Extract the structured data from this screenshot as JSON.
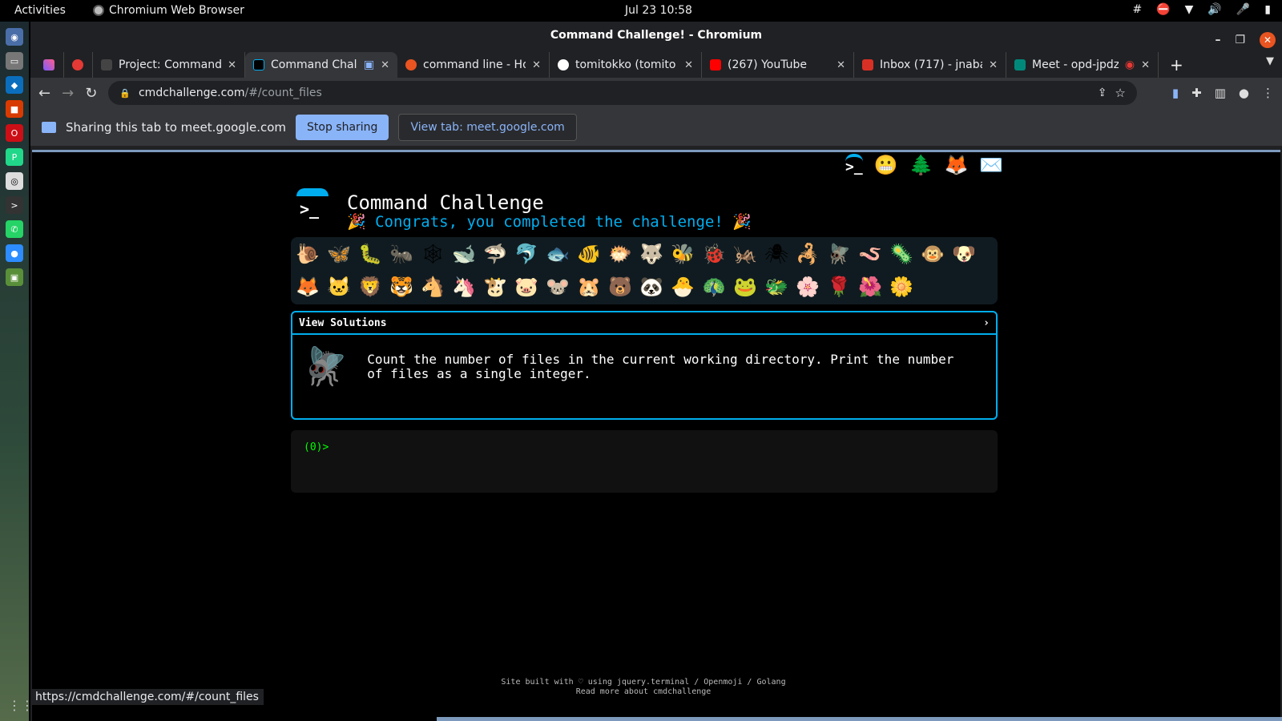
{
  "os": {
    "activities": "Activities",
    "app_name": "Chromium Web Browser",
    "clock": "Jul 23  10:58"
  },
  "window": {
    "title": "Command Challenge! - Chromium",
    "tabs": [
      {
        "label": "",
        "icon": "gradient-a-icon",
        "color": "#7b5cff"
      },
      {
        "label": "",
        "icon": "heart-icon",
        "color": "#e53935"
      },
      {
        "label": "Project: Command",
        "icon": "ofc-icon",
        "color": "#555"
      },
      {
        "label": "Command Chall",
        "icon": "terminal-icon",
        "color": "#00aeef",
        "active": true
      },
      {
        "label": "command line - Ho",
        "icon": "askubuntu-icon",
        "color": "#e95420"
      },
      {
        "label": "tomitokko (tomito",
        "icon": "github-icon",
        "color": "#fff"
      },
      {
        "label": "(267) YouTube",
        "icon": "youtube-icon",
        "color": "#ff0000"
      },
      {
        "label": "Inbox (717) - jnaba",
        "icon": "gmail-icon",
        "color": "#d93025"
      },
      {
        "label": "Meet - opd-jpdz",
        "icon": "meet-icon",
        "color": "#00897b"
      }
    ],
    "new_tab": "+",
    "url_host": "cmdchallenge.com",
    "url_path": "/#/count_files"
  },
  "sharebar": {
    "text": "Sharing this tab to meet.google.com",
    "stop_label": "Stop sharing",
    "view_label": "View tab: meet.google.com"
  },
  "page": {
    "title": "Command Challenge",
    "congrats": "🎉 Congrats, you completed the challenge! 🎉",
    "badges": [
      "🐌",
      "🦋",
      "🐛",
      "🐜",
      "🕸",
      "🐋",
      "🦈",
      "🐬",
      "🐟",
      "🐠",
      "🐡",
      "🐺",
      "🐝",
      "🐞",
      "🦗",
      "🕷",
      "🦂",
      "🪰",
      "🪱",
      "🦠",
      "🐵",
      "🐶",
      "🦊",
      "🐱",
      "🦁",
      "🐯",
      "🐴",
      "🦄",
      "🐮",
      "🐷",
      "🐭",
      "🐹",
      "🐻",
      "🐼",
      "🐣",
      "🦚",
      "🐸",
      "🐲",
      "🌸",
      "🌹",
      "🌺",
      "🌼"
    ],
    "header_icons": [
      "terminal-icon",
      "hint-icon",
      "tree-icon",
      "gitlab-icon",
      "mail-icon"
    ],
    "solutions_label": "View Solutions",
    "solutions_chevron": "›",
    "challenge_text": "Count the number of files in the current working directory. Print the number of files as a single integer.",
    "prompt": "(0)>",
    "footer_line1": "Site built with ♡ using jquery.terminal / Openmoji / Golang",
    "footer_line2": "Read more about cmdchallenge"
  },
  "status_url": "https://cmdchallenge.com/#/count_files",
  "colors": {
    "accent": "#00aeef",
    "chrome_blue": "#8ab4f8",
    "terminal_green": "#00ff00"
  }
}
